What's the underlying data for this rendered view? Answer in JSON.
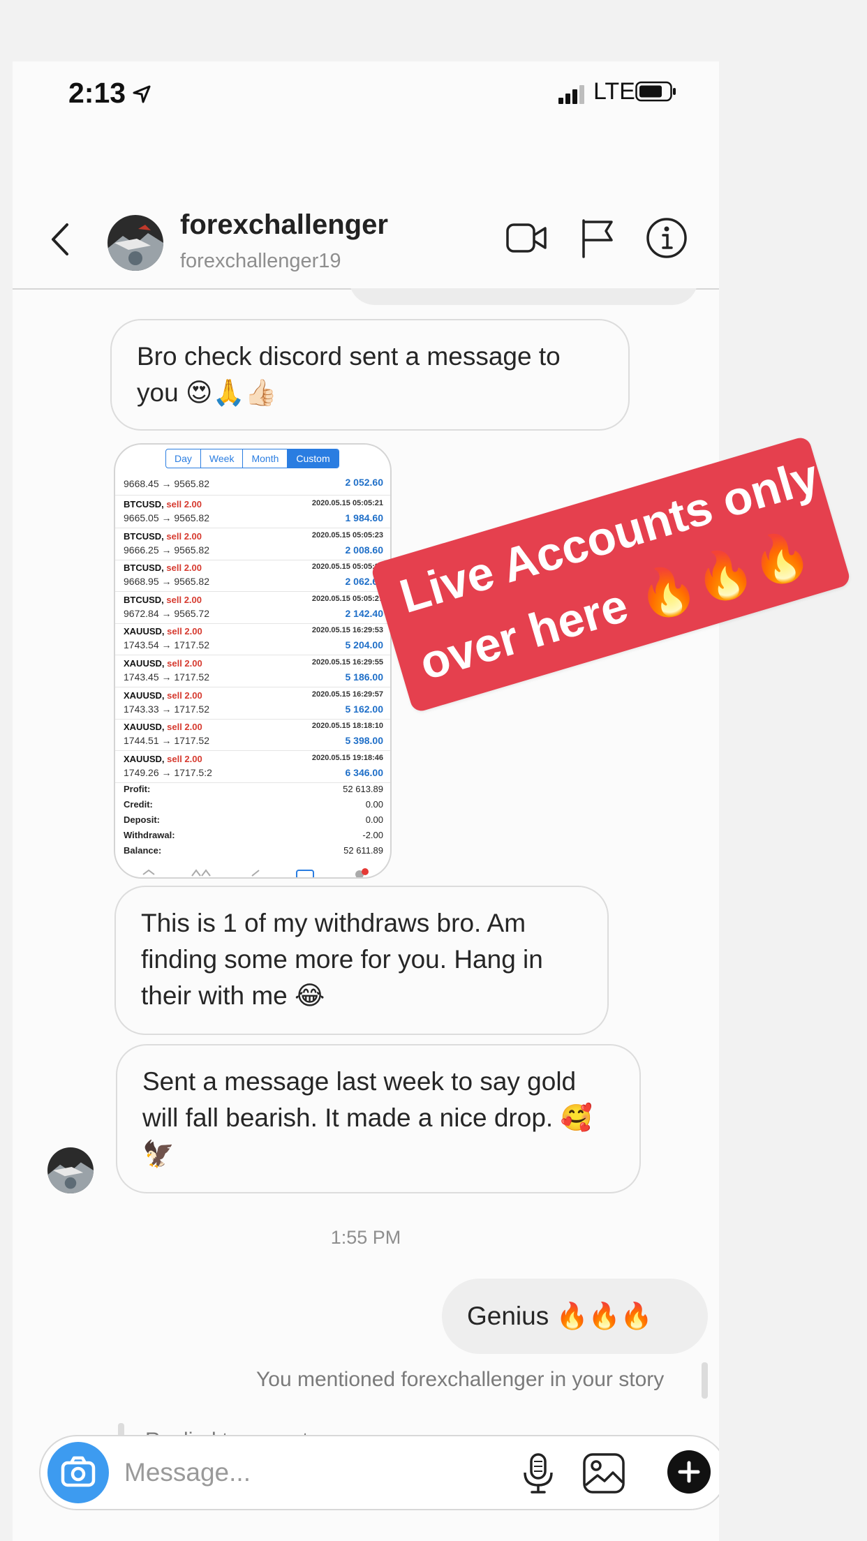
{
  "status_bar": {
    "time": "2:13",
    "network": "LTE"
  },
  "header": {
    "username": "forexchallenger",
    "handle": "forexchallenger19"
  },
  "messages": {
    "m1": "Bro check discord sent a message to you 😍🙏👍🏻",
    "m2": "This is 1 of my withdraws bro. Am finding some more for you. Hang in their with me 😂",
    "m3": "Sent a message last week to say gold will fall bearish. It made a nice drop. 🥰🦅",
    "timestamp": "1:55 PM",
    "my_reply": "Genius 🔥🔥🔥",
    "story_mention": "You mentioned forexchallenger in your story",
    "story_reply": "Replied to your story"
  },
  "trade_screenshot": {
    "tabs": [
      "Day",
      "Week",
      "Month",
      "Custom"
    ],
    "active_tab": "Custom",
    "first_row": {
      "prices": "9668.45 → 9565.82",
      "profit": "2 052.60"
    },
    "trades": [
      {
        "symbol": "BTCUSD,",
        "side": "sell 2.00",
        "date": "2020.05.15 05:05:21",
        "prices": "9665.05 → 9565.82",
        "profit": "1 984.60"
      },
      {
        "symbol": "BTCUSD,",
        "side": "sell 2.00",
        "date": "2020.05.15 05:05:23",
        "prices": "9666.25 → 9565.82",
        "profit": "2 008.60"
      },
      {
        "symbol": "BTCUSD,",
        "side": "sell 2.00",
        "date": "2020.05.15 05:05:25",
        "prices": "9668.95 → 9565.82",
        "profit": "2 062.60"
      },
      {
        "symbol": "BTCUSD,",
        "side": "sell 2.00",
        "date": "2020.05.15 05:05:27",
        "prices": "9672.84 → 9565.72",
        "profit": "2 142.40"
      },
      {
        "symbol": "XAUUSD,",
        "side": "sell 2.00",
        "date": "2020.05.15 16:29:53",
        "prices": "1743.54 → 1717.52",
        "profit": "5 204.00"
      },
      {
        "symbol": "XAUUSD,",
        "side": "sell 2.00",
        "date": "2020.05.15 16:29:55",
        "prices": "1743.45 → 1717.52",
        "profit": "5 186.00"
      },
      {
        "symbol": "XAUUSD,",
        "side": "sell 2.00",
        "date": "2020.05.15 16:29:57",
        "prices": "1743.33 → 1717.52",
        "profit": "5 162.00"
      },
      {
        "symbol": "XAUUSD,",
        "side": "sell 2.00",
        "date": "2020.05.15 18:18:10",
        "prices": "1744.51 → 1717.52",
        "profit": "5 398.00"
      },
      {
        "symbol": "XAUUSD,",
        "side": "sell 2.00",
        "date": "2020.05.15 19:18:46",
        "prices": "1749.26 → 1717.5:2",
        "profit": "6 346.00"
      }
    ],
    "summary": [
      {
        "label": "Profit:",
        "value": "52 613.89"
      },
      {
        "label": "Credit:",
        "value": "0.00"
      },
      {
        "label": "Deposit:",
        "value": "0.00"
      },
      {
        "label": "Withdrawal:",
        "value": "-2.00"
      },
      {
        "label": "Balance:",
        "value": "52 611.89"
      }
    ]
  },
  "sticker": {
    "line1": "Live Accounts only",
    "line2": "over here 🔥🔥🔥"
  },
  "composer": {
    "placeholder": "Message..."
  },
  "colors": {
    "sticker_bg": "#e5404e",
    "camera_button": "#3d9bf0",
    "profit_blue": "#1f6fc8",
    "sell_red": "#d63a2f"
  },
  "icons": [
    "location-arrow-icon",
    "signal-icon",
    "battery-icon",
    "back-chevron-icon",
    "video-call-icon",
    "flag-icon",
    "info-icon",
    "camera-icon",
    "microphone-icon",
    "gallery-icon",
    "plus-icon"
  ]
}
